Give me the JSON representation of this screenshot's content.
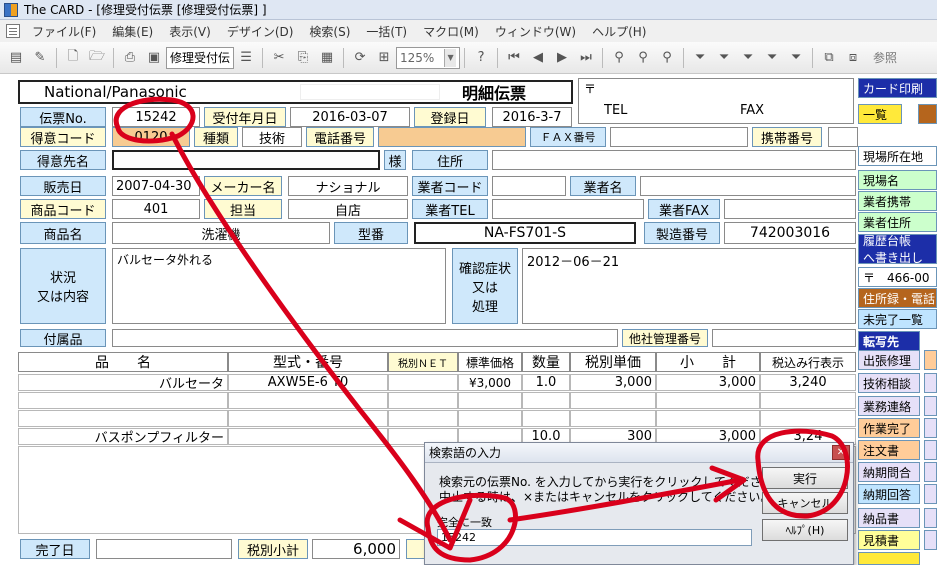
{
  "window": {
    "title": "The CARD - [修理受付伝票 [修理受付伝票] ]"
  },
  "menu": [
    "ファイル(F)",
    "編集(E)",
    "表示(V)",
    "デザイン(D)",
    "検索(S)",
    "一括(T)",
    "マクロ(M)",
    "ウィンドウ(W)",
    "ヘルプ(H)"
  ],
  "toolbar": {
    "form_select": "修理受付伝",
    "zoom": "125%",
    "ref_label": "参照"
  },
  "header": {
    "brand": "National/Panasonic",
    "slip_title": "明細伝票",
    "postal_mark": "〒",
    "tel_label": "TEL",
    "fax_label": "FAX"
  },
  "fields": {
    "slip_no_label": "伝票No.",
    "slip_no": "15242",
    "received_date_label": "受付年月日",
    "received_date": "2016-03-07",
    "registered_label": "登録日",
    "registered_date": "2016-3-7",
    "customer_code_label": "得意コード",
    "customer_code": "0120",
    "type_label": "種類",
    "type_value": "技術",
    "phone_label": "電話番号",
    "fax_no_label": "ＦＡＸ番号",
    "mobile_label": "携帯番号",
    "customer_name_label": "得意先名",
    "honorific": "様",
    "address_label": "住所",
    "sale_date_label": "販売日",
    "sale_date": "2007-04-30",
    "maker_label": "メーカー名",
    "maker": "ナショナル",
    "vendor_code_label": "業者コード",
    "vendor_name_label": "業者名",
    "product_code_label": "商品コード",
    "product_code": "401",
    "staff_label": "担当",
    "staff": "自店",
    "vendor_tel_label": "業者TEL",
    "vendor_fax_label": "業者FAX",
    "product_name_label": "商品名",
    "product_name": "洗濯機",
    "model_label": "型番",
    "model": "NA-FS701-S",
    "serial_label": "製造番号",
    "serial": "742003016",
    "status_label_1": "状況",
    "status_label_2": "又は内容",
    "status_text": "バルセータ外れる",
    "confirm_label_1": "確認症状",
    "confirm_label_2": "又は",
    "confirm_label_3": "処理",
    "confirm_text": "2012－06－21",
    "accessory_label": "付属品",
    "other_mgmt_label": "他社管理番号",
    "done_date_label": "完了日",
    "tax_subtotal_label": "税別小計",
    "tax_subtotal": "6,000"
  },
  "grid": {
    "headers": [
      "品　　名",
      "型式・番号",
      "税別ＮＥＴ",
      "標準価格",
      "数量",
      "税別単価",
      "小　　計",
      "税込み行表示"
    ],
    "rows": [
      [
        "バルセータ",
        "AXW5E-6 T0",
        "",
        "¥3,000",
        "1.0",
        "3,000",
        "3,000",
        "3,240"
      ],
      [
        "",
        "",
        "",
        "",
        "",
        "",
        "",
        ""
      ],
      [
        "",
        "",
        "",
        "",
        "",
        "",
        "",
        ""
      ],
      [
        "バスポンプフィルター",
        "",
        "",
        "",
        "10.0",
        "300",
        "3,000",
        "3,24"
      ]
    ]
  },
  "right_panel": {
    "top": [
      "カード印刷",
      "一覧"
    ],
    "r1": "現場所在地",
    "r2": "現場名",
    "r3": "業者携帯",
    "r4": "業者住所",
    "history": [
      "履歴台帳",
      "へ書き出し"
    ],
    "postal": "〒　466-00",
    "address_book": "住所録・電話",
    "incomplete": "未完了一覧",
    "transfer_label": "転写先",
    "actions": [
      "出張修理",
      "技術相談",
      "業務連絡",
      "作業完了",
      "注文書",
      "納期問合",
      "納期回答",
      "納品書",
      "見積書"
    ]
  },
  "dialog": {
    "title": "検索語の入力",
    "msg1": "検索元の伝票No. を入力してから実行をクリックしてください。",
    "msg2": "中止する時は、×またはキャンセルをクリックしてください。",
    "match_label": "完全に一致",
    "input_value": "15242",
    "ok": "実行",
    "cancel": "キャンセル",
    "help": "ﾍﾙﾌﾟ(H)"
  }
}
